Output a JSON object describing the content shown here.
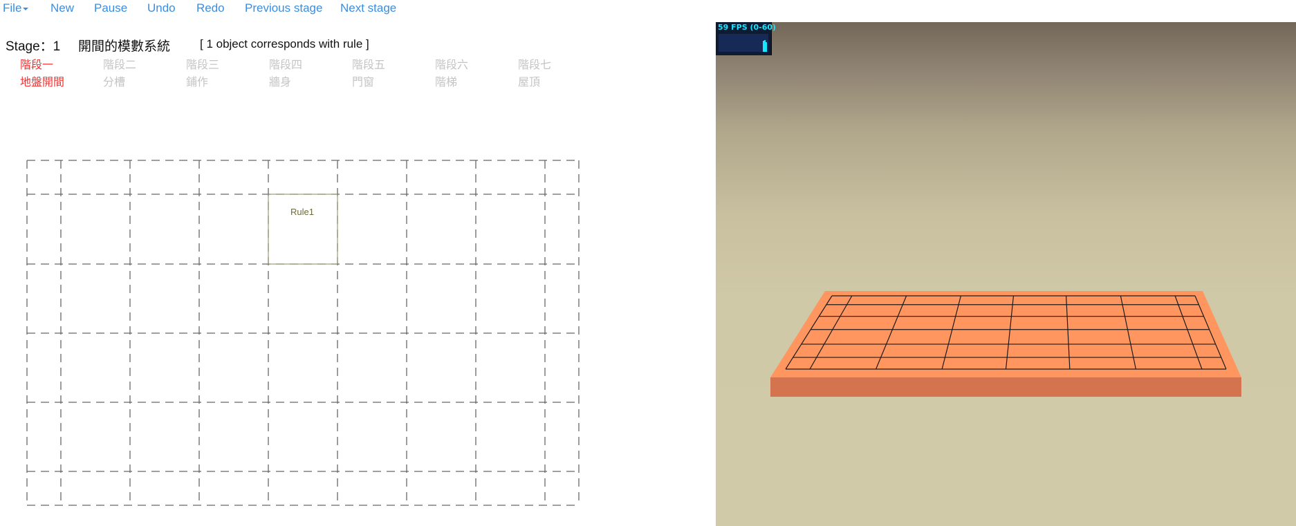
{
  "menu": {
    "file": "File",
    "new": "New",
    "pause": "Pause",
    "undo": "Undo",
    "redo": "Redo",
    "previous_stage": "Previous stage",
    "next_stage": "Next stage"
  },
  "stage": {
    "label": "Stage：1",
    "system_name": "開間的模數系統",
    "rule_status": "[ 1 object corresponds with rule ]"
  },
  "stages": [
    {
      "phase": "階段一",
      "name": "地盤開間",
      "active": true
    },
    {
      "phase": "階段二",
      "name": "分槽",
      "active": false
    },
    {
      "phase": "階段三",
      "name": "鋪作",
      "active": false
    },
    {
      "phase": "階段四",
      "name": "牆身",
      "active": false
    },
    {
      "phase": "階段五",
      "name": "門窗",
      "active": false
    },
    {
      "phase": "階段六",
      "name": "階梯",
      "active": false
    },
    {
      "phase": "階段七",
      "name": "屋頂",
      "active": false
    }
  ],
  "grid": {
    "rule_label": "Rule1"
  },
  "viewport": {
    "fps_text": "59 FPS (0-60)"
  },
  "colors": {
    "link": "#3a8ee0",
    "active_stage": "#ee3333",
    "inactive_stage": "#c4c4c4",
    "platform_top": "#ff9660",
    "platform_side": "#d4744f",
    "fps": "#18e6ff"
  }
}
